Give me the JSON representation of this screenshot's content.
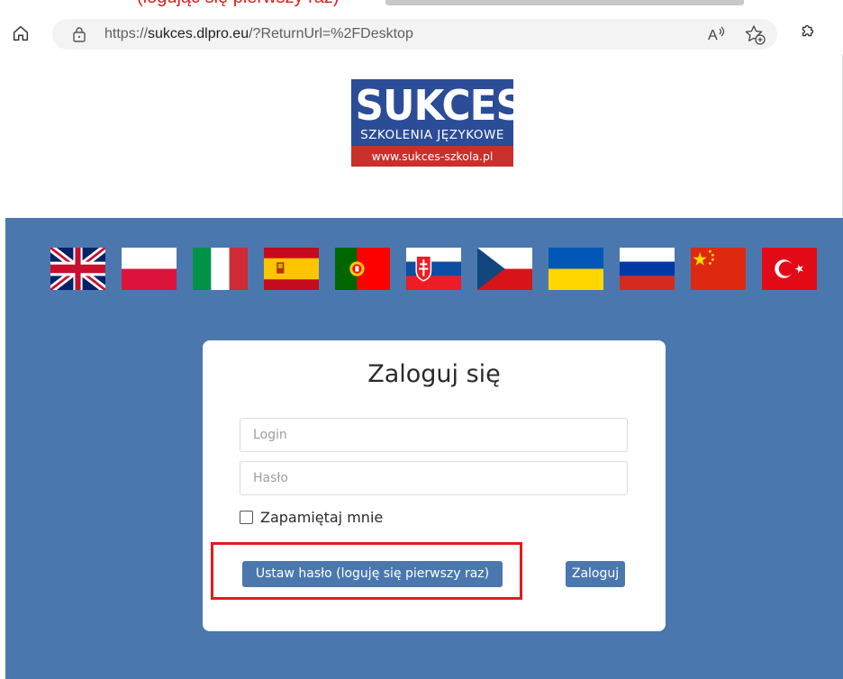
{
  "annotation": {
    "cropped_text": "(logując się pierwszy raz)",
    "highlight_color": "#e21b1b"
  },
  "browser": {
    "url_prefix": "https://",
    "url_domain": "sukces.dlpro.eu",
    "url_path": "/?ReturnUrl=%2FDesktop",
    "icons": [
      "home-icon",
      "lock-icon",
      "read-aloud-icon",
      "favorites-icon",
      "extensions-icon"
    ]
  },
  "logo": {
    "name": "SUKCES",
    "tagline": "SZKOLENIA JĘZYKOWE",
    "website": "www.sukces-szkola.pl"
  },
  "colors": {
    "brand_blue": "#4a78ae",
    "logo_blue": "#2b4c97",
    "logo_red": "#c9302c"
  },
  "languages": [
    "english",
    "polish",
    "italian",
    "spanish",
    "portuguese",
    "slovak",
    "czech",
    "ukrainian",
    "russian",
    "chinese",
    "turkish"
  ],
  "login": {
    "title": "Zaloguj się",
    "login_placeholder": "Login",
    "password_placeholder": "Hasło",
    "remember_label": "Zapamiętaj mnie",
    "remember_checked": false,
    "set_password_button": "Ustaw hasło (loguję się pierwszy raz)",
    "login_button": "Zaloguj"
  }
}
